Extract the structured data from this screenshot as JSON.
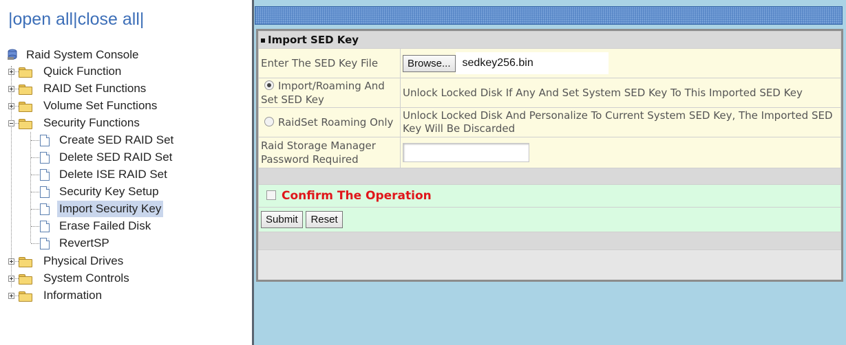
{
  "nav": {
    "open_all": "open all",
    "close_all": "close all",
    "separator": "|"
  },
  "tree": {
    "root": "Raid System Console",
    "items": [
      {
        "label": "Quick Function",
        "expanded": false
      },
      {
        "label": "RAID Set Functions",
        "expanded": false
      },
      {
        "label": "Volume Set Functions",
        "expanded": false
      },
      {
        "label": "Security Functions",
        "expanded": true
      },
      {
        "label": "Physical Drives",
        "expanded": false
      },
      {
        "label": "System Controls",
        "expanded": false
      },
      {
        "label": "Information",
        "expanded": false
      }
    ],
    "security_children": [
      {
        "label": "Create SED RAID Set"
      },
      {
        "label": "Delete SED RAID Set"
      },
      {
        "label": "Delete ISE RAID Set"
      },
      {
        "label": "Security Key Setup"
      },
      {
        "label": "Import Security Key",
        "selected": true
      },
      {
        "label": "Erase Failed Disk"
      },
      {
        "label": "RevertSP"
      }
    ]
  },
  "form": {
    "title": "Import SED Key",
    "key_file_label": "Enter The SED Key File",
    "browse_label": "Browse...",
    "file_name": "sedkey256.bin",
    "option1_label": "Import/Roaming And Set SED Key",
    "option1_desc": "Unlock Locked Disk If Any And Set System SED Key To This Imported SED Key",
    "option1_checked": true,
    "option2_label": "RaidSet Roaming Only",
    "option2_desc": "Unlock Locked Disk And Personalize To Current System SED Key, The Imported SED Key Will Be Discarded",
    "option2_checked": false,
    "password_label": "Raid Storage Manager Password Required",
    "password_value": "",
    "confirm_label": "Confirm The Operation",
    "confirm_checked": false,
    "submit_label": "Submit",
    "reset_label": "Reset"
  },
  "colors": {
    "sidebar_bg": "#ffffff",
    "content_bg": "#aad3e5",
    "header_bg": "#d9d9d9",
    "input_row_bg": "#fdfbe0",
    "confirm_row_bg": "#d9fbe1",
    "confirm_text": "#e0161a",
    "link_color": "#3d6fb8"
  }
}
